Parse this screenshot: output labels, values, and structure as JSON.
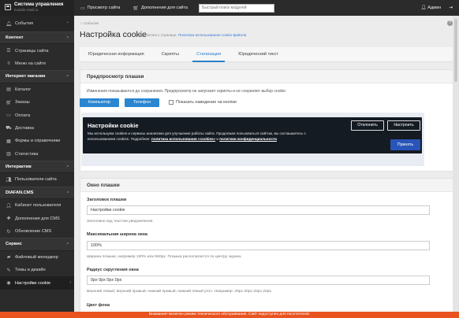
{
  "brand": {
    "title": "Система управления",
    "subtitle": "module-retail.ru"
  },
  "topbar": {
    "preview_site": "Просмотр сайта",
    "addons": "Дополнения для сайта",
    "search_placeholder": "Быстрый поиск модулей",
    "user": "Админ"
  },
  "sidebar": {
    "events": "События",
    "sections": [
      {
        "title": "Контент",
        "items": [
          "Страницы сайта",
          "Меню на сайте"
        ]
      },
      {
        "title": "Интернет магазин",
        "items": [
          "Каталог",
          "Заказы",
          "Оплата",
          "Доставка",
          "Формы и справочники",
          "Статистика"
        ]
      },
      {
        "title": "Интерактив",
        "items": [
          "Пользователи сайта"
        ]
      },
      {
        "title": "DIAFAN.CMS",
        "items": [
          "Кабинет пользователя",
          "Дополнения для CMS",
          "Обновление CMS"
        ]
      },
      {
        "title": "Сервис",
        "items": [
          "Файловый менеджер",
          "Темы и дизайн",
          "Настройки cookie"
        ]
      }
    ]
  },
  "main": {
    "breadcrumb": "События",
    "help": "?",
    "title": "Настройка cookie",
    "title_sub_prefix": "Подключен к странице:",
    "title_sub_link": "Политика использования cookie-файлов",
    "tabs": [
      {
        "label": "Юридическая информация"
      },
      {
        "label": "Скрипты"
      },
      {
        "label": "Стилизация"
      },
      {
        "label": "Юридический текст"
      }
    ],
    "preview": {
      "heading": "Предпросмотр плашки",
      "note": "Изменения показываются до сохранения. Предпросмотр не запускает скрипты и не сохраняет выбор cookie.",
      "btn_computer": "Компьютер",
      "btn_phone": "Телефон",
      "hover_label": "Показать наведение на кнопки",
      "banner": {
        "title": "Настройки cookie",
        "text_1": "Мы используем cookies и сервисы аналитики для улучшения работы сайта. Продолжая пользоваться сайтом,",
        "text_2": "вы соглашаетесь с использованием cookies. Подробнее:",
        "link_policy": "политика использования «cookies»",
        "text_and": "и",
        "link_privacy": "политики конфиденциальности",
        "btn_reject": "Отклонить",
        "btn_configure": "Настроить",
        "btn_accept": "Принять"
      }
    },
    "window": {
      "heading": "Окно плашки",
      "title_label": "Заголовок плашки",
      "title_value": "Настройки cookie",
      "title_hint": "Заголовок над текстом уведомления.",
      "width_label": "Максимальная ширина окна",
      "width_value": "100%",
      "width_hint": "Ширина плашки, например 100% или 960px. Плашка располагается по центру экрана.",
      "radius_label": "Радиус скругления окна",
      "radius_value": "0px 0px 0px 0px",
      "radius_hint": "Верхний левый, верхний правый, нижний правый, нижний левый угол. Например: 20px 20px 20px 20px.",
      "bg_label": "Цвет фона"
    }
  },
  "bottom_notice": "Внимание! включен режим технического обслуживания. Сайт недоступен для посетителей.",
  "colors": {
    "accent": "#2a86d1",
    "sidebar": "#2b2b2b",
    "notice": "#e8531f",
    "banner": "#151b22"
  }
}
